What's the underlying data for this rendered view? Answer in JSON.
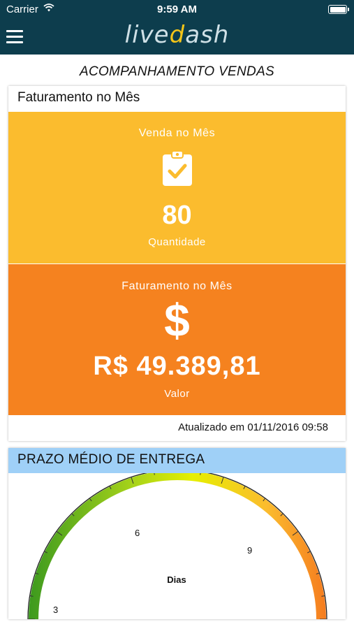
{
  "status_bar": {
    "carrier": "Carrier",
    "time": "9:59 AM"
  },
  "nav": {
    "logo_left": "live",
    "logo_accent": "d",
    "logo_right": "ash"
  },
  "page": {
    "title": "ACOMPANHAMENTO VENDAS"
  },
  "billing_card": {
    "title": "Faturamento no Mês",
    "sales_tile": {
      "label": "Venda no Mês",
      "icon": "clipboard-check-icon",
      "value": "80",
      "sub_label": "Quantidade",
      "color": "#fbbc2e"
    },
    "revenue_tile": {
      "label": "Faturamento no Mês",
      "icon": "dollar-icon",
      "icon_glyph": "$",
      "value": "R$ 49.389,81",
      "sub_label": "Valor",
      "color": "#f5821f"
    },
    "updated": "Atualizado em 01/11/2016 09:58"
  },
  "delivery_card": {
    "title": "PRAZO MÉDIO DE ENTREGA",
    "header_color": "#9fd0f7",
    "gauge": {
      "unit_label": "Dias",
      "tick_labels": [
        "3",
        "6",
        "9"
      ],
      "colors": [
        "#3d9a1e",
        "#e6ef00",
        "#f57c1f"
      ]
    }
  }
}
